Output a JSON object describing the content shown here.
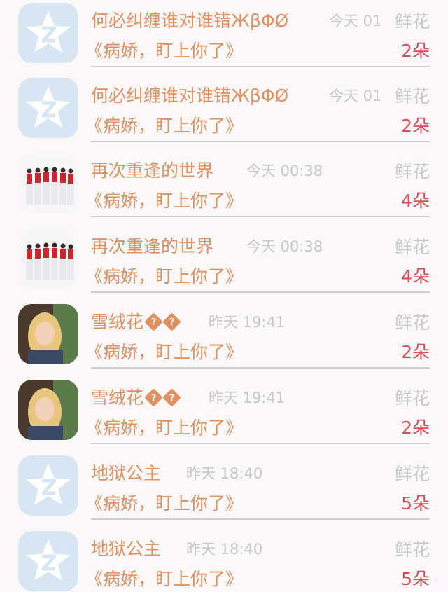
{
  "messages": [
    {
      "avatar": "qq-star-icon",
      "name": "何必纠缠谁对谁错ЖβΦØ",
      "time": "今天 01",
      "gift_label": "鲜花",
      "title": "《病娇，盯上你了》",
      "count": "2朵"
    },
    {
      "avatar": "qq-star-icon",
      "name": "何必纠缠谁对谁错ЖβΦØ",
      "time": "今天 01",
      "gift_label": "鲜花",
      "title": "《病娇，盯上你了》",
      "count": "2朵"
    },
    {
      "avatar": "dancers-photo",
      "name": "再次重逢的世界",
      "time": "今天 00:38",
      "gift_label": "鲜花",
      "title": "《病娇，盯上你了》",
      "count": "4朵"
    },
    {
      "avatar": "dancers-photo",
      "name": "再次重逢的世界",
      "time": "今天 00:38",
      "gift_label": "鲜花",
      "title": "《病娇，盯上你了》",
      "count": "4朵"
    },
    {
      "avatar": "child-photo",
      "name": "雪绒花",
      "name_suffix": [
        "?",
        "?"
      ],
      "time": "昨天 19:41",
      "gift_label": "鲜花",
      "title": "《病娇，盯上你了》",
      "count": "2朵"
    },
    {
      "avatar": "child-photo",
      "name": "雪绒花",
      "name_suffix": [
        "?",
        "?"
      ],
      "time": "昨天 19:41",
      "gift_label": "鲜花",
      "title": "《病娇，盯上你了》",
      "count": "2朵"
    },
    {
      "avatar": "qq-star-icon",
      "name": "地狱公主",
      "time": "昨天 18:40",
      "gift_label": "鲜花",
      "title": "《病娇，盯上你了》",
      "count": "5朵"
    },
    {
      "avatar": "qq-star-icon",
      "name": "地狱公主",
      "time": "昨天 18:40",
      "gift_label": "鲜花",
      "title": "《病娇，盯上你了》",
      "count": "5朵"
    }
  ],
  "colors": {
    "name": "#e0915f",
    "title": "#e0915f",
    "time": "#c7c7c7",
    "gift_label": "#c9c9c9",
    "count": "#d94e56",
    "divider": "#cfcfcf",
    "background": "#faf8f9"
  }
}
